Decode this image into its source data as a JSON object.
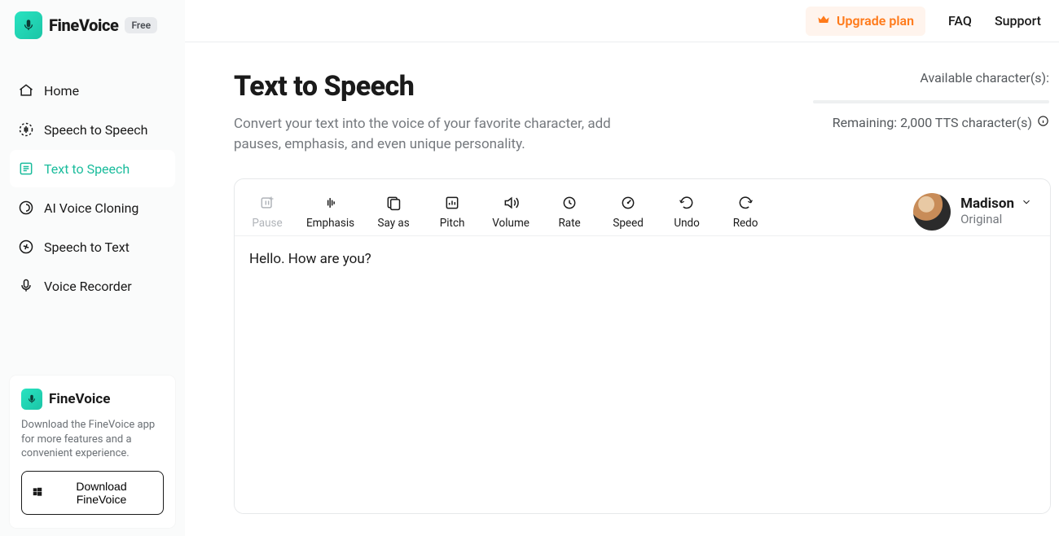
{
  "brand": {
    "name": "FineVoice",
    "plan_badge": "Free"
  },
  "topbar": {
    "upgrade": "Upgrade plan",
    "faq": "FAQ",
    "support": "Support"
  },
  "sidebar": {
    "items": [
      {
        "label": "Home"
      },
      {
        "label": "Speech to Speech"
      },
      {
        "label": "Text to Speech"
      },
      {
        "label": "AI Voice Cloning"
      },
      {
        "label": "Speech to Text"
      },
      {
        "label": "Voice Recorder"
      }
    ]
  },
  "promo": {
    "title": "FineVoice",
    "desc": "Download the FineVoice app for more features and a convenient experience.",
    "button": "Download FineVoice"
  },
  "page": {
    "title": "Text to Speech",
    "subtitle": "Convert your text into the voice of your favorite character, add pauses, emphasis, and even unique personality."
  },
  "quota": {
    "available_label": "Available character(s):",
    "remaining": "Remaining: 2,000 TTS character(s)"
  },
  "tools": {
    "pause": "Pause",
    "emphasis": "Emphasis",
    "sayas": "Say as",
    "pitch": "Pitch",
    "volume": "Volume",
    "rate": "Rate",
    "speed": "Speed",
    "undo": "Undo",
    "redo": "Redo"
  },
  "voice": {
    "name": "Madison",
    "style": "Original"
  },
  "editor": {
    "text": "Hello. How are you?"
  }
}
